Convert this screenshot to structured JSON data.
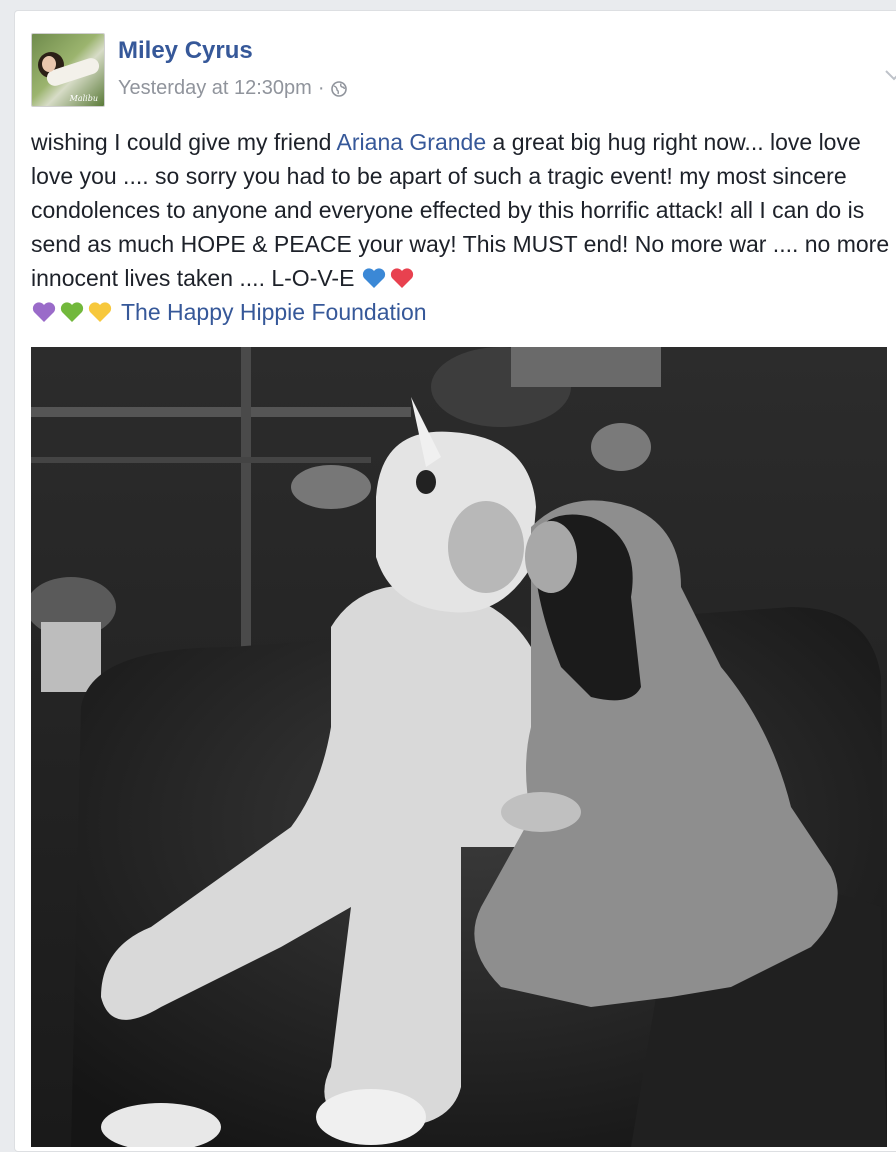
{
  "post": {
    "author": "Miley Cyrus",
    "timestamp": "Yesterday at 12:30pm",
    "separator": "·",
    "privacy_icon": "globe-icon",
    "menu_icon": "chevron-down-icon",
    "avatar_signature": "Malibu",
    "text": {
      "part1": "wishing I could give my friend ",
      "mention": "Ariana Grande",
      "part2": " a great big hug right now... love love love you .... so sorry you had to be apart of such a tragic event! my most sincere condolences to anyone and everyone effected by this horrific attack! all I can do is send as much HOPE & PEACE your way! This MUST end! No more war .... no more innocent lives taken .... L-O-V-E ",
      "emojis": [
        "blue-heart",
        "red-heart",
        "purple-heart",
        "green-heart",
        "yellow-heart"
      ],
      "page_link": "The Happy Hippie Foundation"
    },
    "photo_icon": "post-photo"
  },
  "colors": {
    "link": "#365899",
    "meta": "#90949c",
    "text": "#1d2129",
    "background": "#e9ebee",
    "blue_heart": "#3b88d6",
    "red_heart": "#e8414f",
    "purple_heart": "#9a6bc9",
    "green_heart": "#72b83c",
    "yellow_heart": "#f7c83c"
  }
}
